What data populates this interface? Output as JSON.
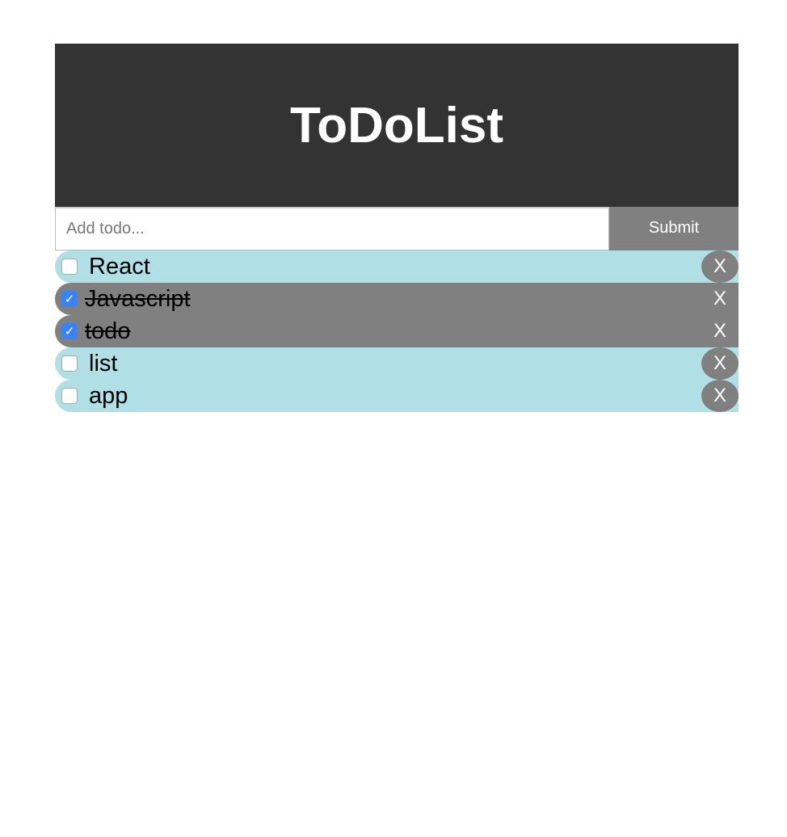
{
  "header": {
    "title": "ToDoList"
  },
  "form": {
    "placeholder": "Add todo...",
    "value": "",
    "submit_label": "Submit"
  },
  "todos": [
    {
      "title": "React",
      "completed": false,
      "delete_label": "X"
    },
    {
      "title": "Javascript",
      "completed": true,
      "delete_label": "X"
    },
    {
      "title": "todo",
      "completed": true,
      "delete_label": "X"
    },
    {
      "title": "list",
      "completed": false,
      "delete_label": "X"
    },
    {
      "title": "app",
      "completed": false,
      "delete_label": "X"
    }
  ],
  "colors": {
    "header": "#333333",
    "item": "#b0e0e6",
    "completed_item": "#808080",
    "button": "#808080"
  }
}
